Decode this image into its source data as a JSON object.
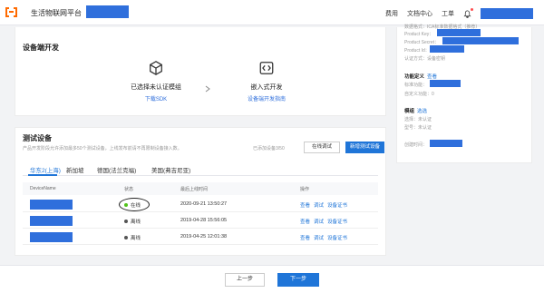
{
  "header": {
    "app_name": "生活物联网平台",
    "nav": [
      "费用",
      "文档中心",
      "工单"
    ]
  },
  "device_dev": {
    "title": "设备端开发",
    "step1": {
      "label": "已选择未认证模组",
      "link": "下载SDK",
      "icon": "cube-icon"
    },
    "step2": {
      "label": "嵌入式开发",
      "link": "设备端开发指南",
      "icon": "code-icon"
    }
  },
  "test": {
    "title": "测试设备",
    "desc": "产品开发阶段允许添加最多50个测试设备，上线发布前请不再限制设备接入数。",
    "quota": "已添加设备3/50",
    "online_btn": "在线调试",
    "new_btn": "新增测试设备",
    "tabs": [
      "华东2(上海)",
      "新加坡",
      "德国(法兰克福)",
      "美国(弗吉尼亚)"
    ],
    "columns": [
      "DeviceName",
      "状态",
      "最后上线时间",
      "操作"
    ],
    "rows": [
      {
        "status": "在线",
        "status_color": "#52c41a",
        "time": "2020-09-21 13:50:27",
        "ops": [
          "查看",
          "调试",
          "设备证书"
        ]
      },
      {
        "status": "离线",
        "status_color": "#555555",
        "time": "2019-04-28 15:56:05",
        "ops": [
          "查看",
          "调试",
          "设备证书"
        ]
      },
      {
        "status": "离线",
        "status_color": "#555555",
        "time": "2019-04-25 12:01:38",
        "ops": [
          "查看",
          "调试",
          "设备证书"
        ]
      }
    ]
  },
  "panel": {
    "auth_mode": "数据格式：ICA标准数据格式（推荐）",
    "product_key": "Product Key：",
    "product_secret": "Product Secret：",
    "product_id": "Product Id：",
    "auth_type": "认证方式：设备密钥",
    "func_title": "功能定义",
    "func_link": "查看",
    "std_func": "标准功能：",
    "custom_func": "自定义功能：0",
    "module_title": "模组",
    "module_link": "选选",
    "select_label": "选择：未认证",
    "model_label": "型号：未认证",
    "created_label": "创建时间："
  },
  "footer": {
    "prev": "上一步",
    "next": "下一步"
  },
  "colors": {
    "accent": "#1f75d8",
    "redaction": "#2f6fdc",
    "brand": "#ff6a00"
  }
}
